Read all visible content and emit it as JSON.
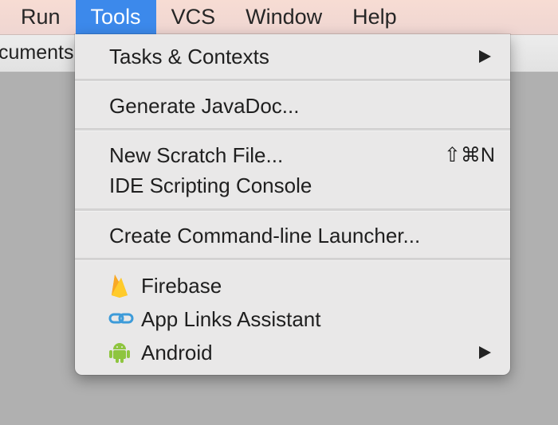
{
  "menubar": {
    "items": [
      {
        "label": "Run"
      },
      {
        "label": "Tools"
      },
      {
        "label": "VCS"
      },
      {
        "label": "Window"
      },
      {
        "label": "Help"
      }
    ]
  },
  "background": {
    "documents_tab_label": "cuments"
  },
  "tools_menu": {
    "items": [
      {
        "label": "Tasks & Contexts",
        "submenu": true
      },
      {
        "label": "Generate JavaDoc..."
      },
      {
        "label": "New Scratch File...",
        "shortcut": "⇧⌘N"
      },
      {
        "label": "IDE Scripting Console"
      },
      {
        "label": "Create Command-line Launcher..."
      },
      {
        "label": "Firebase",
        "icon": "firebase-icon"
      },
      {
        "label": "App Links Assistant",
        "icon": "app-links-icon"
      },
      {
        "label": "Android",
        "icon": "android-icon",
        "submenu": true
      }
    ]
  },
  "colors": {
    "menu_highlight": "#3c89eb",
    "firebase_flame": "#f8b72a",
    "app_links_blue": "#3d9bd9",
    "android_green": "#8ec53f"
  }
}
